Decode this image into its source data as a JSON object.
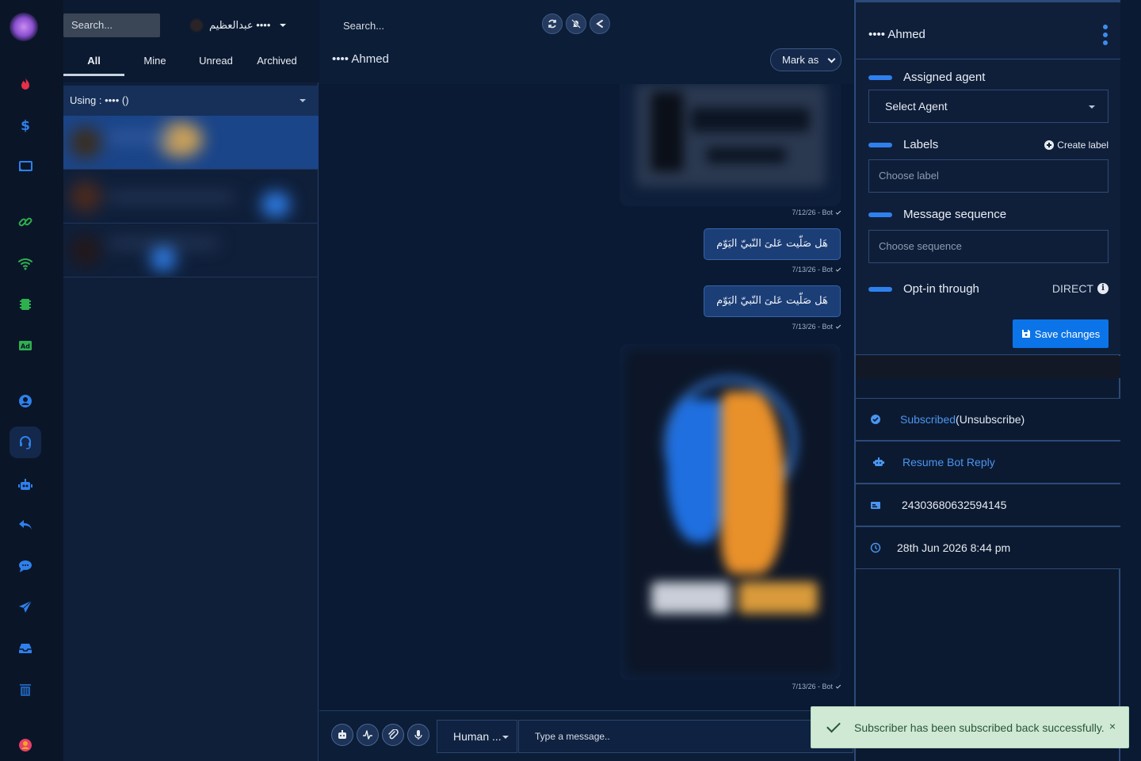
{
  "colors": {
    "accent": "#2f80ed",
    "primary_button": "#0b74e8",
    "panel_bg": "#0f1f3a",
    "selected_row": "#1b4589",
    "toast_bg": "#cfe9d4"
  },
  "nav": {
    "icons": [
      "app-logo",
      "fire-icon",
      "dollar-icon",
      "cast-icon",
      "link-icon",
      "wifi-icon",
      "chip-icon",
      "ad-icon",
      "user-circle-icon",
      "headset-icon",
      "robot-icon",
      "reply-icon",
      "chat-icon",
      "send-icon",
      "inbox-icon",
      "trash-icon",
      "profile-icon"
    ]
  },
  "list": {
    "search_placeholder": "Search...",
    "account_name": "عبدالعظيم ••••",
    "tabs": [
      "All",
      "Mine",
      "Unread",
      "Archived"
    ],
    "active_tab": "All",
    "using_label": "Using : •••• ()"
  },
  "chat": {
    "search_placeholder": "Search...",
    "contact_name": "•••• Ahmed",
    "mark_as_label": "Mark as",
    "messages": [
      {
        "type": "image",
        "stamp": "7/12/26 - Bot"
      },
      {
        "type": "text",
        "text": "هَل صَلّيت عَلىَ النّبيّ اليَوّم",
        "stamp": "7/13/26 - Bot"
      },
      {
        "type": "text",
        "text": "هَل صَلّيت عَلىَ النّبيّ اليَوّم",
        "stamp": "7/13/26 - Bot"
      },
      {
        "type": "image",
        "stamp": "7/13/26 - Bot"
      }
    ],
    "mode_label": "Human ...",
    "message_placeholder": "Type a message.."
  },
  "details": {
    "contact_name": "•••• Ahmed",
    "assigned_agent_label": "Assigned agent",
    "agent_select_value": "Select Agent",
    "labels_label": "Labels",
    "create_label": "Create label",
    "label_placeholder": "Choose label",
    "sequence_label": "Message sequence",
    "sequence_placeholder": "Choose sequence",
    "optin_label": "Opt-in through",
    "optin_value": "DIRECT",
    "save_label": "Save changes",
    "subscribed_link": "Subscribed",
    "unsubscribe_text": "(Unsubscribe)",
    "resume_bot": "Resume Bot Reply",
    "subscriber_id": "24303680632594145",
    "subscribed_at": "28th Jun 2026 8:44 pm"
  },
  "toast": {
    "message": "Subscriber has been subscribed back successfully.",
    "close": "×"
  }
}
